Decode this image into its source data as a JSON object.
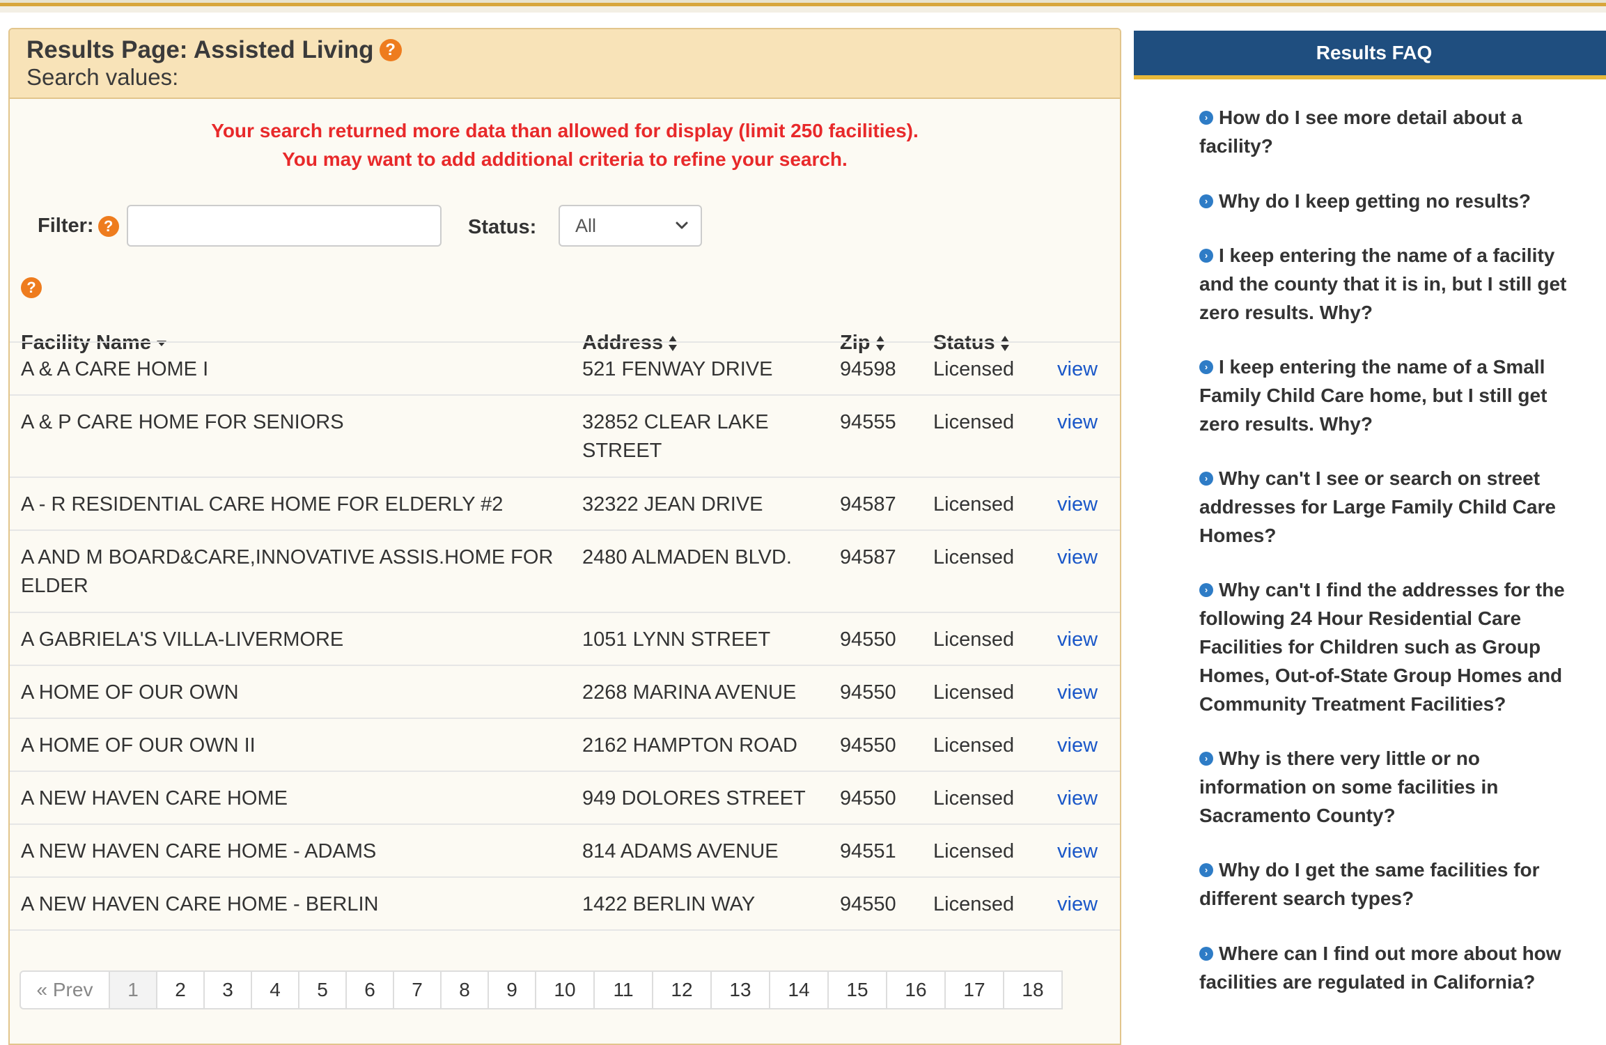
{
  "header": {
    "title": "Results Page: Assisted Living",
    "help_icon": "?",
    "subtitle": "Search values:"
  },
  "warning": {
    "line1": "Your search returned more data than allowed for display (limit 250 facilities).",
    "line2": "You may want to add additional criteria to refine your search."
  },
  "filter": {
    "label": "Filter:",
    "value": "",
    "status_label": "Status:",
    "status_value": "All"
  },
  "table": {
    "columns": [
      "Facility Name",
      "Address",
      "Zip",
      "Status"
    ],
    "view_label": "view",
    "rows": [
      {
        "name": "A & A CARE HOME I",
        "address": "521 FENWAY DRIVE",
        "zip": "94598",
        "status": "Licensed"
      },
      {
        "name": "A & P CARE HOME FOR SENIORS",
        "address": "32852 CLEAR LAKE STREET",
        "zip": "94555",
        "status": "Licensed"
      },
      {
        "name": "A - R RESIDENTIAL CARE HOME FOR ELDERLY #2",
        "address": "32322 JEAN DRIVE",
        "zip": "94587",
        "status": "Licensed"
      },
      {
        "name": "A AND M BOARD&CARE,INNOVATIVE ASSIS.HOME FOR ELDER",
        "address": "2480 ALMADEN BLVD.",
        "zip": "94587",
        "status": "Licensed"
      },
      {
        "name": "A GABRIELA'S VILLA-LIVERMORE",
        "address": "1051 LYNN STREET",
        "zip": "94550",
        "status": "Licensed"
      },
      {
        "name": "A HOME OF OUR OWN",
        "address": "2268 MARINA AVENUE",
        "zip": "94550",
        "status": "Licensed"
      },
      {
        "name": "A HOME OF OUR OWN II",
        "address": "2162 HAMPTON ROAD",
        "zip": "94550",
        "status": "Licensed"
      },
      {
        "name": "A NEW HAVEN CARE HOME",
        "address": "949 DOLORES STREET",
        "zip": "94550",
        "status": "Licensed"
      },
      {
        "name": "A NEW HAVEN CARE HOME - ADAMS",
        "address": "814 ADAMS AVENUE",
        "zip": "94551",
        "status": "Licensed"
      },
      {
        "name": "A NEW HAVEN CARE HOME - BERLIN",
        "address": "1422 BERLIN WAY",
        "zip": "94550",
        "status": "Licensed"
      }
    ]
  },
  "pagination": {
    "prev_label": "« Prev",
    "pages": [
      "1",
      "2",
      "3",
      "4",
      "5",
      "6",
      "7",
      "8",
      "9",
      "10",
      "11",
      "12",
      "13",
      "14",
      "15",
      "16",
      "17",
      "18"
    ],
    "current": "1"
  },
  "faq": {
    "title": "Results FAQ",
    "items": [
      "How do I see more detail about a facility?",
      "Why do I keep getting no results?",
      "I keep entering the name of a facility and the county that it is in, but I still get zero results. Why?",
      "I keep entering the name of a Small Family Child Care home, but I still get zero results. Why?",
      "Why can't I see or search on street addresses for Large Family Child Care Homes?",
      "Why can't I find the addresses for the following 24 Hour Residential Care Facilities for Children such as Group Homes, Out-of-State Group Homes and Community Treatment Facilities?",
      "Why is there very little or no information on some facilities in Sacramento County?",
      "Why do I get the same facilities for different search types?",
      "Where can I find out more about how facilities are regulated in California?"
    ]
  },
  "colors": {
    "header_bg": "#f8e3b8",
    "warning": "#e8292a",
    "link": "#1a57c8",
    "help_orange": "#ee7c1e",
    "faq_header": "#1f4e7f",
    "faq_accent": "#e8b93a"
  }
}
